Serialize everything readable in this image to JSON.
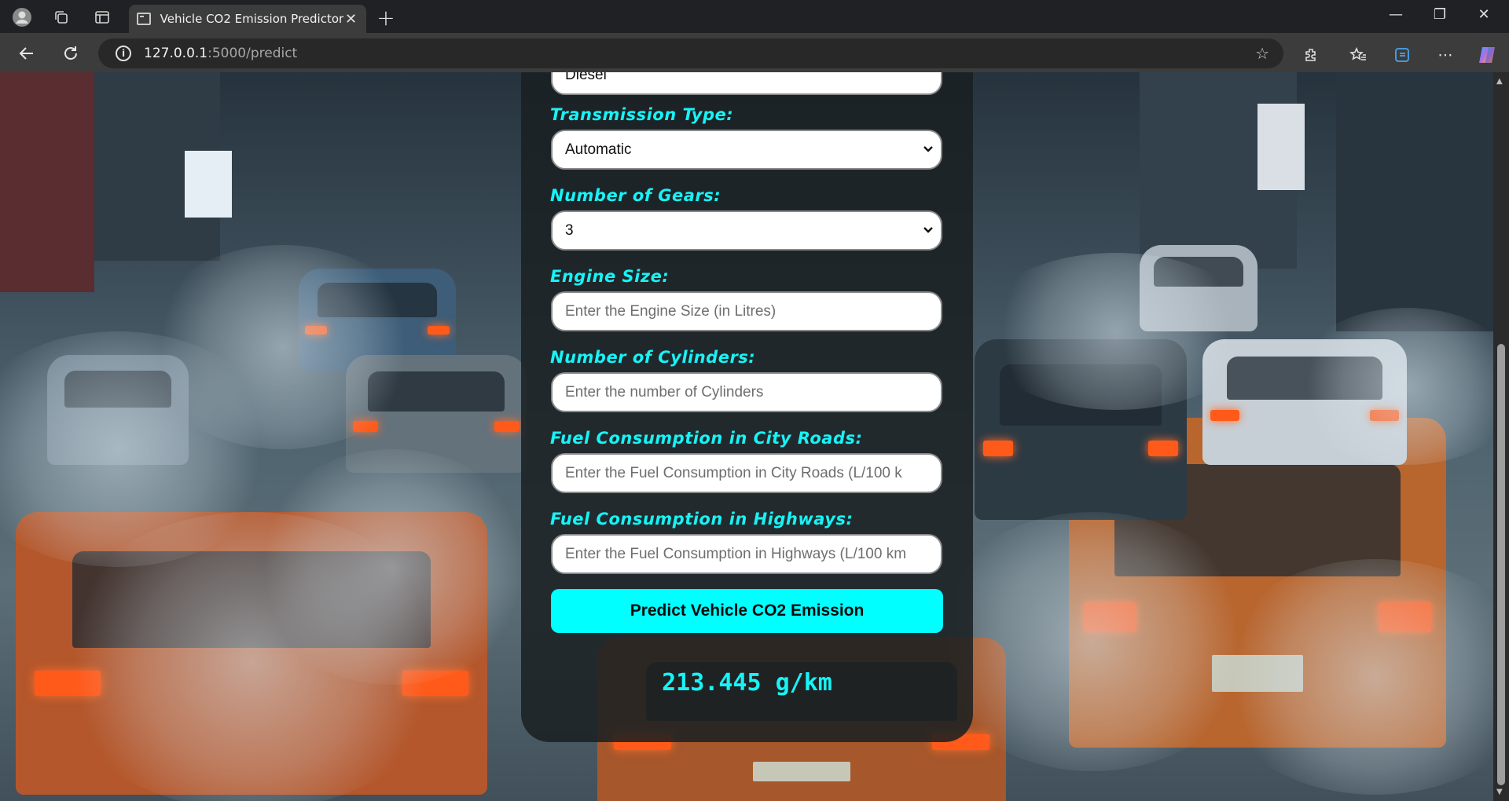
{
  "browser": {
    "tab_title": "Vehicle CO2 Emission Predictor",
    "url_host": "127.0.0.1",
    "url_path": ":5000/predict"
  },
  "form": {
    "fuel_type_partial": "Diesel",
    "transmission_label": "Transmission Type:",
    "transmission_value": "Automatic",
    "gears_label": "Number of Gears:",
    "gears_value": "3",
    "engine_label": "Engine Size:",
    "engine_placeholder": "Enter the Engine Size (in Litres)",
    "cylinders_label": "Number of Cylinders:",
    "cylinders_placeholder": "Enter the number of Cylinders",
    "city_label": "Fuel Consumption in City Roads:",
    "city_placeholder": "Enter the Fuel Consumption in City Roads (L/100 k",
    "highway_label": "Fuel Consumption in Highways:",
    "highway_placeholder": "Enter the Fuel Consumption in Highways (L/100 km",
    "submit_label": "Predict Vehicle CO2 Emission"
  },
  "result": {
    "value": "213.445 g/km"
  }
}
